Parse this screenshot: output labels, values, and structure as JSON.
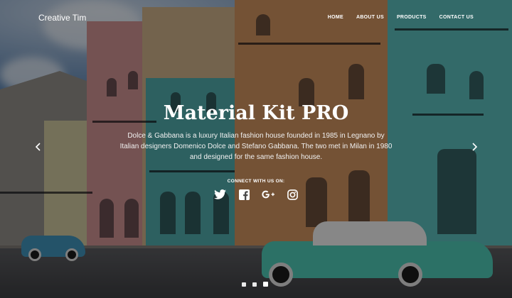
{
  "navbar": {
    "brand": "Creative Tim",
    "links": [
      "HOME",
      "ABOUT US",
      "PRODUCTS",
      "CONTACT US"
    ]
  },
  "hero": {
    "title": "Material Kit PRO",
    "description": "Dolce & Gabbana is a luxury Italian fashion house founded in 1985 in Legnano by Italian designers Domenico Dolce and Stefano Gabbana. The two met in Milan in 1980 and designed for the same fashion house.",
    "connect_label": "CONNECT WITH US ON:",
    "socials": [
      "twitter-icon",
      "facebook-icon",
      "google-plus-icon",
      "instagram-icon"
    ]
  },
  "carousel": {
    "slide_count": 3,
    "active_index": 2
  },
  "colors": {
    "text": "#ffffff",
    "overlay": "rgba(0,0,0,0.42)"
  }
}
